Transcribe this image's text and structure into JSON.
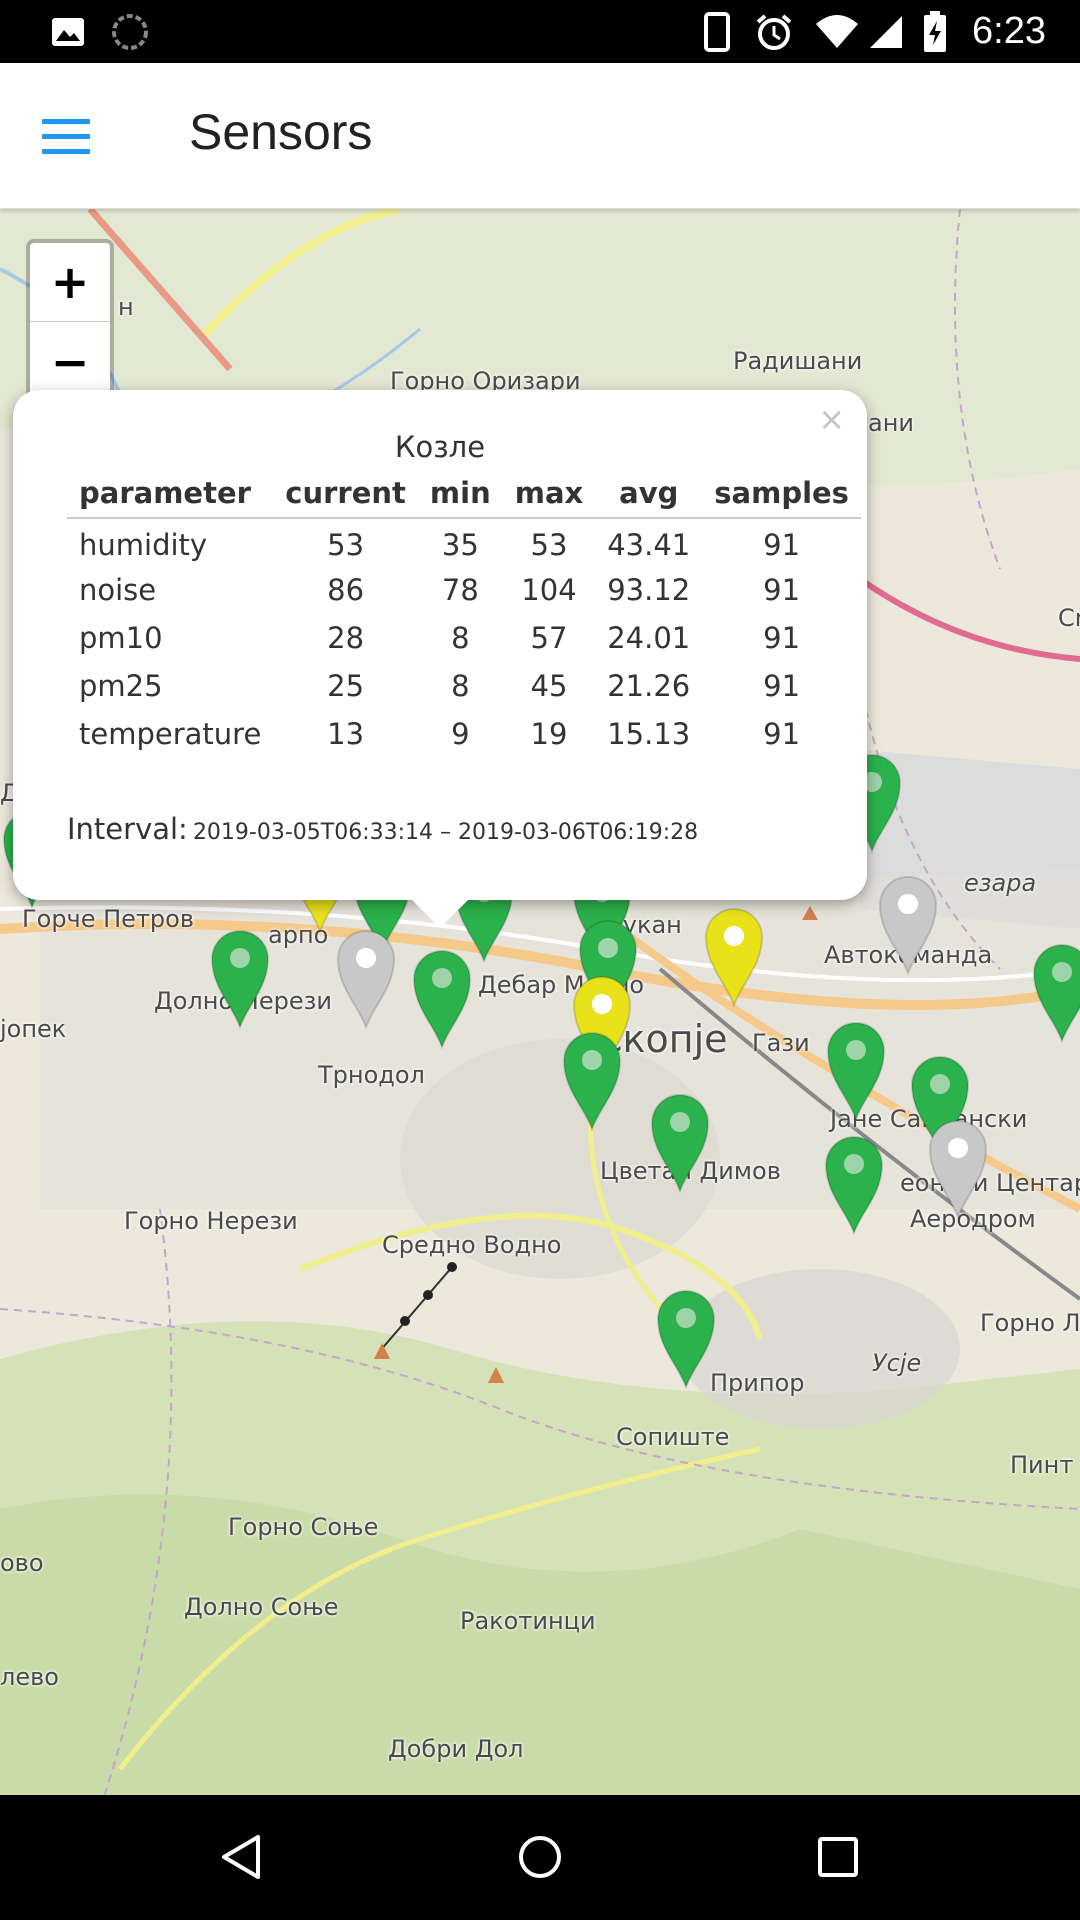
{
  "status_bar": {
    "time": "6:23",
    "icons": [
      "image-icon",
      "sync-icon",
      "phone-icon",
      "alarm-icon",
      "wifi-icon",
      "signal-icon",
      "battery-charging-icon"
    ]
  },
  "app_bar": {
    "title": "Sensors",
    "menu_icon": "hamburger-menu-icon"
  },
  "map": {
    "zoom_in_label": "+",
    "zoom_out_label": "−",
    "place_labels": {
      "radishani": "Радишани",
      "gorno_orizari": "Горно Оризари",
      "gorche_petrov": "Горче Петров",
      "dolno_nerezi": "Долно Нерези",
      "trnodol": "Трнодол",
      "debar_maalo": "Дебар Маало",
      "skopje": "Скопје",
      "gazi_baba": "Гази",
      "dukandzik": "Дукан",
      "avtokomanda": "Автокоманда",
      "zhelezara": "езара",
      "jane_sandanski": "Јане Сандански",
      "tsvetan_dimov": "Цветан Димов",
      "aerodrom": "Аеродром",
      "centar": "еонски Центар",
      "gorno_nerezi": "Горно Нерези",
      "sredno_vodno": "Средно Водно",
      "gorno_lisiche": "Горно Л",
      "usje": "Усје",
      "pripor": "Припор",
      "sopishte": "Сопиште",
      "pinto": "Пинт",
      "gorno_sonje": "Горно Соње",
      "dolno_sonje": "Долно Соње",
      "rakotinci": "Ракотинци",
      "dobri_dol": "Добри Дол",
      "left_ovo": "ово",
      "left_levo": "лево",
      "left_opek": "јопек",
      "left_ani": "ани",
      "left_n": "н",
      "left_d": "Д",
      "right_cr": "Cr",
      "karpo": "арпо"
    },
    "marker_colors": {
      "green": "#2bb24c",
      "yellow": "#e9e21a",
      "gray": "#c8c8c8"
    }
  },
  "popup": {
    "title": "Козле",
    "close_label": "×",
    "columns": [
      "parameter",
      "current",
      "min",
      "max",
      "avg",
      "samples"
    ],
    "rows": [
      [
        "humidity",
        "53",
        "35",
        "53",
        "43.41",
        "91"
      ],
      [
        "noise",
        "86",
        "78",
        "104",
        "93.12",
        "91"
      ],
      [
        "pm10",
        "28",
        "8",
        "57",
        "24.01",
        "91"
      ],
      [
        "pm25",
        "25",
        "8",
        "45",
        "21.26",
        "91"
      ],
      [
        "temperature",
        "13",
        "9",
        "19",
        "15.13",
        "91"
      ]
    ],
    "interval_label": "Interval:",
    "interval_value": "2019-03-05T06:33:14 – 2019-03-06T06:19:28"
  },
  "nav_bar": {
    "icons": [
      "back-icon",
      "home-icon",
      "recents-icon"
    ]
  }
}
